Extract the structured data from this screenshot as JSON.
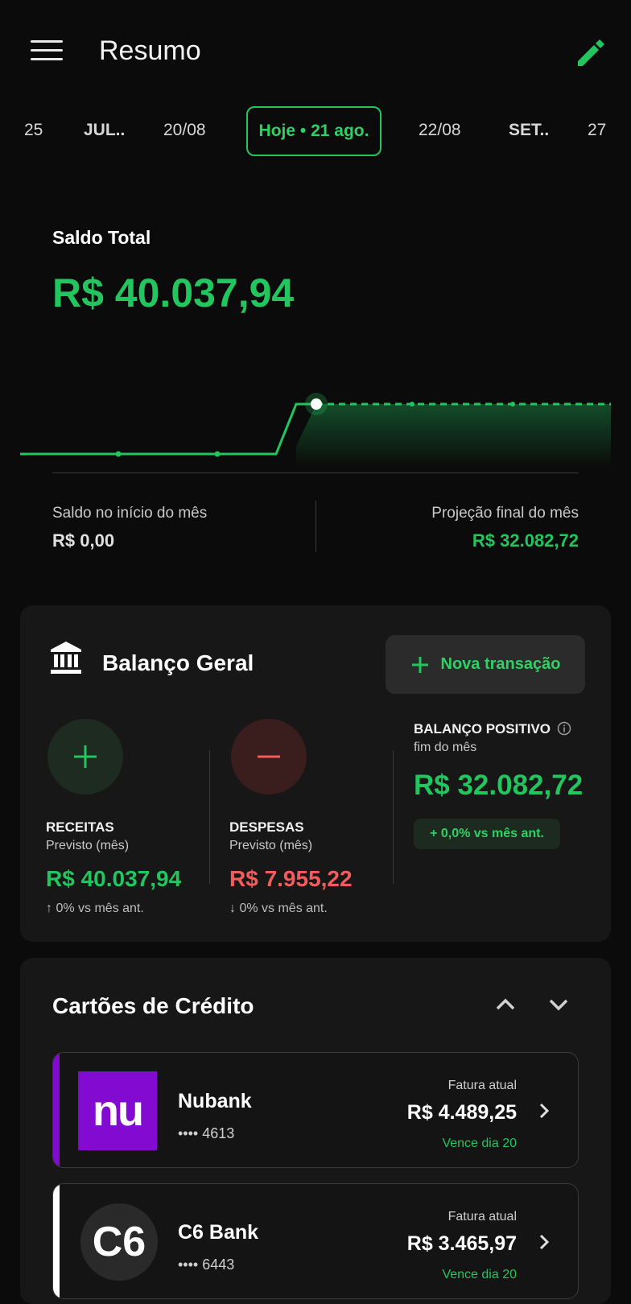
{
  "header": {
    "title": "Resumo"
  },
  "dates": [
    "25",
    "JUL..",
    "20/08",
    "Hoje • 21 ago.",
    "22/08",
    "SET..",
    "27"
  ],
  "saldo": {
    "label": "Saldo Total",
    "value": "R$ 40.037,94",
    "inicio_label": "Saldo no início do mês",
    "inicio_value": "R$ 0,00",
    "projecao_label": "Projeção final do mês",
    "projecao_value": "R$ 32.082,72"
  },
  "balanco": {
    "title": "Balanço Geral",
    "nova_transacao": "Nova transação",
    "receitas": {
      "label": "RECEITAS",
      "sub": "Previsto (mês)",
      "value": "R$ 40.037,94",
      "trend": "↑ 0% vs mês ant."
    },
    "despesas": {
      "label": "DESPESAS",
      "sub": "Previsto (mês)",
      "value": "R$ 7.955,22",
      "trend": "↓ 0% vs mês ant."
    },
    "positivo": {
      "label": "BALANÇO POSITIVO",
      "sub": "fim do mês",
      "value": "R$ 32.082,72",
      "badge": "+ 0,0% vs mês ant."
    }
  },
  "cartoes": {
    "title": "Cartões de Crédito",
    "items": [
      {
        "name": "Nubank",
        "number": "•••• 4613",
        "fatura_label": "Fatura atual",
        "fatura_value": "R$ 4.489,25",
        "vence": "Vence dia 20",
        "logo_text": "nu",
        "accent": "#820ad1"
      },
      {
        "name": "C6 Bank",
        "number": "•••• 6443",
        "fatura_label": "Fatura atual",
        "fatura_value": "R$ 3.465,97",
        "vence": "Vence dia 20",
        "logo_text": "C6",
        "accent": "#ffffff"
      }
    ]
  },
  "colors": {
    "accent_green": "#22c55e",
    "expense_red": "#f25c5c",
    "background": "#0b0b0b"
  },
  "icons": [
    "menu-icon",
    "pencil-icon",
    "bank-icon",
    "plus-icon",
    "minus-icon",
    "info-icon",
    "chevron-up-icon",
    "chevron-down-icon",
    "chevron-right-icon"
  ]
}
